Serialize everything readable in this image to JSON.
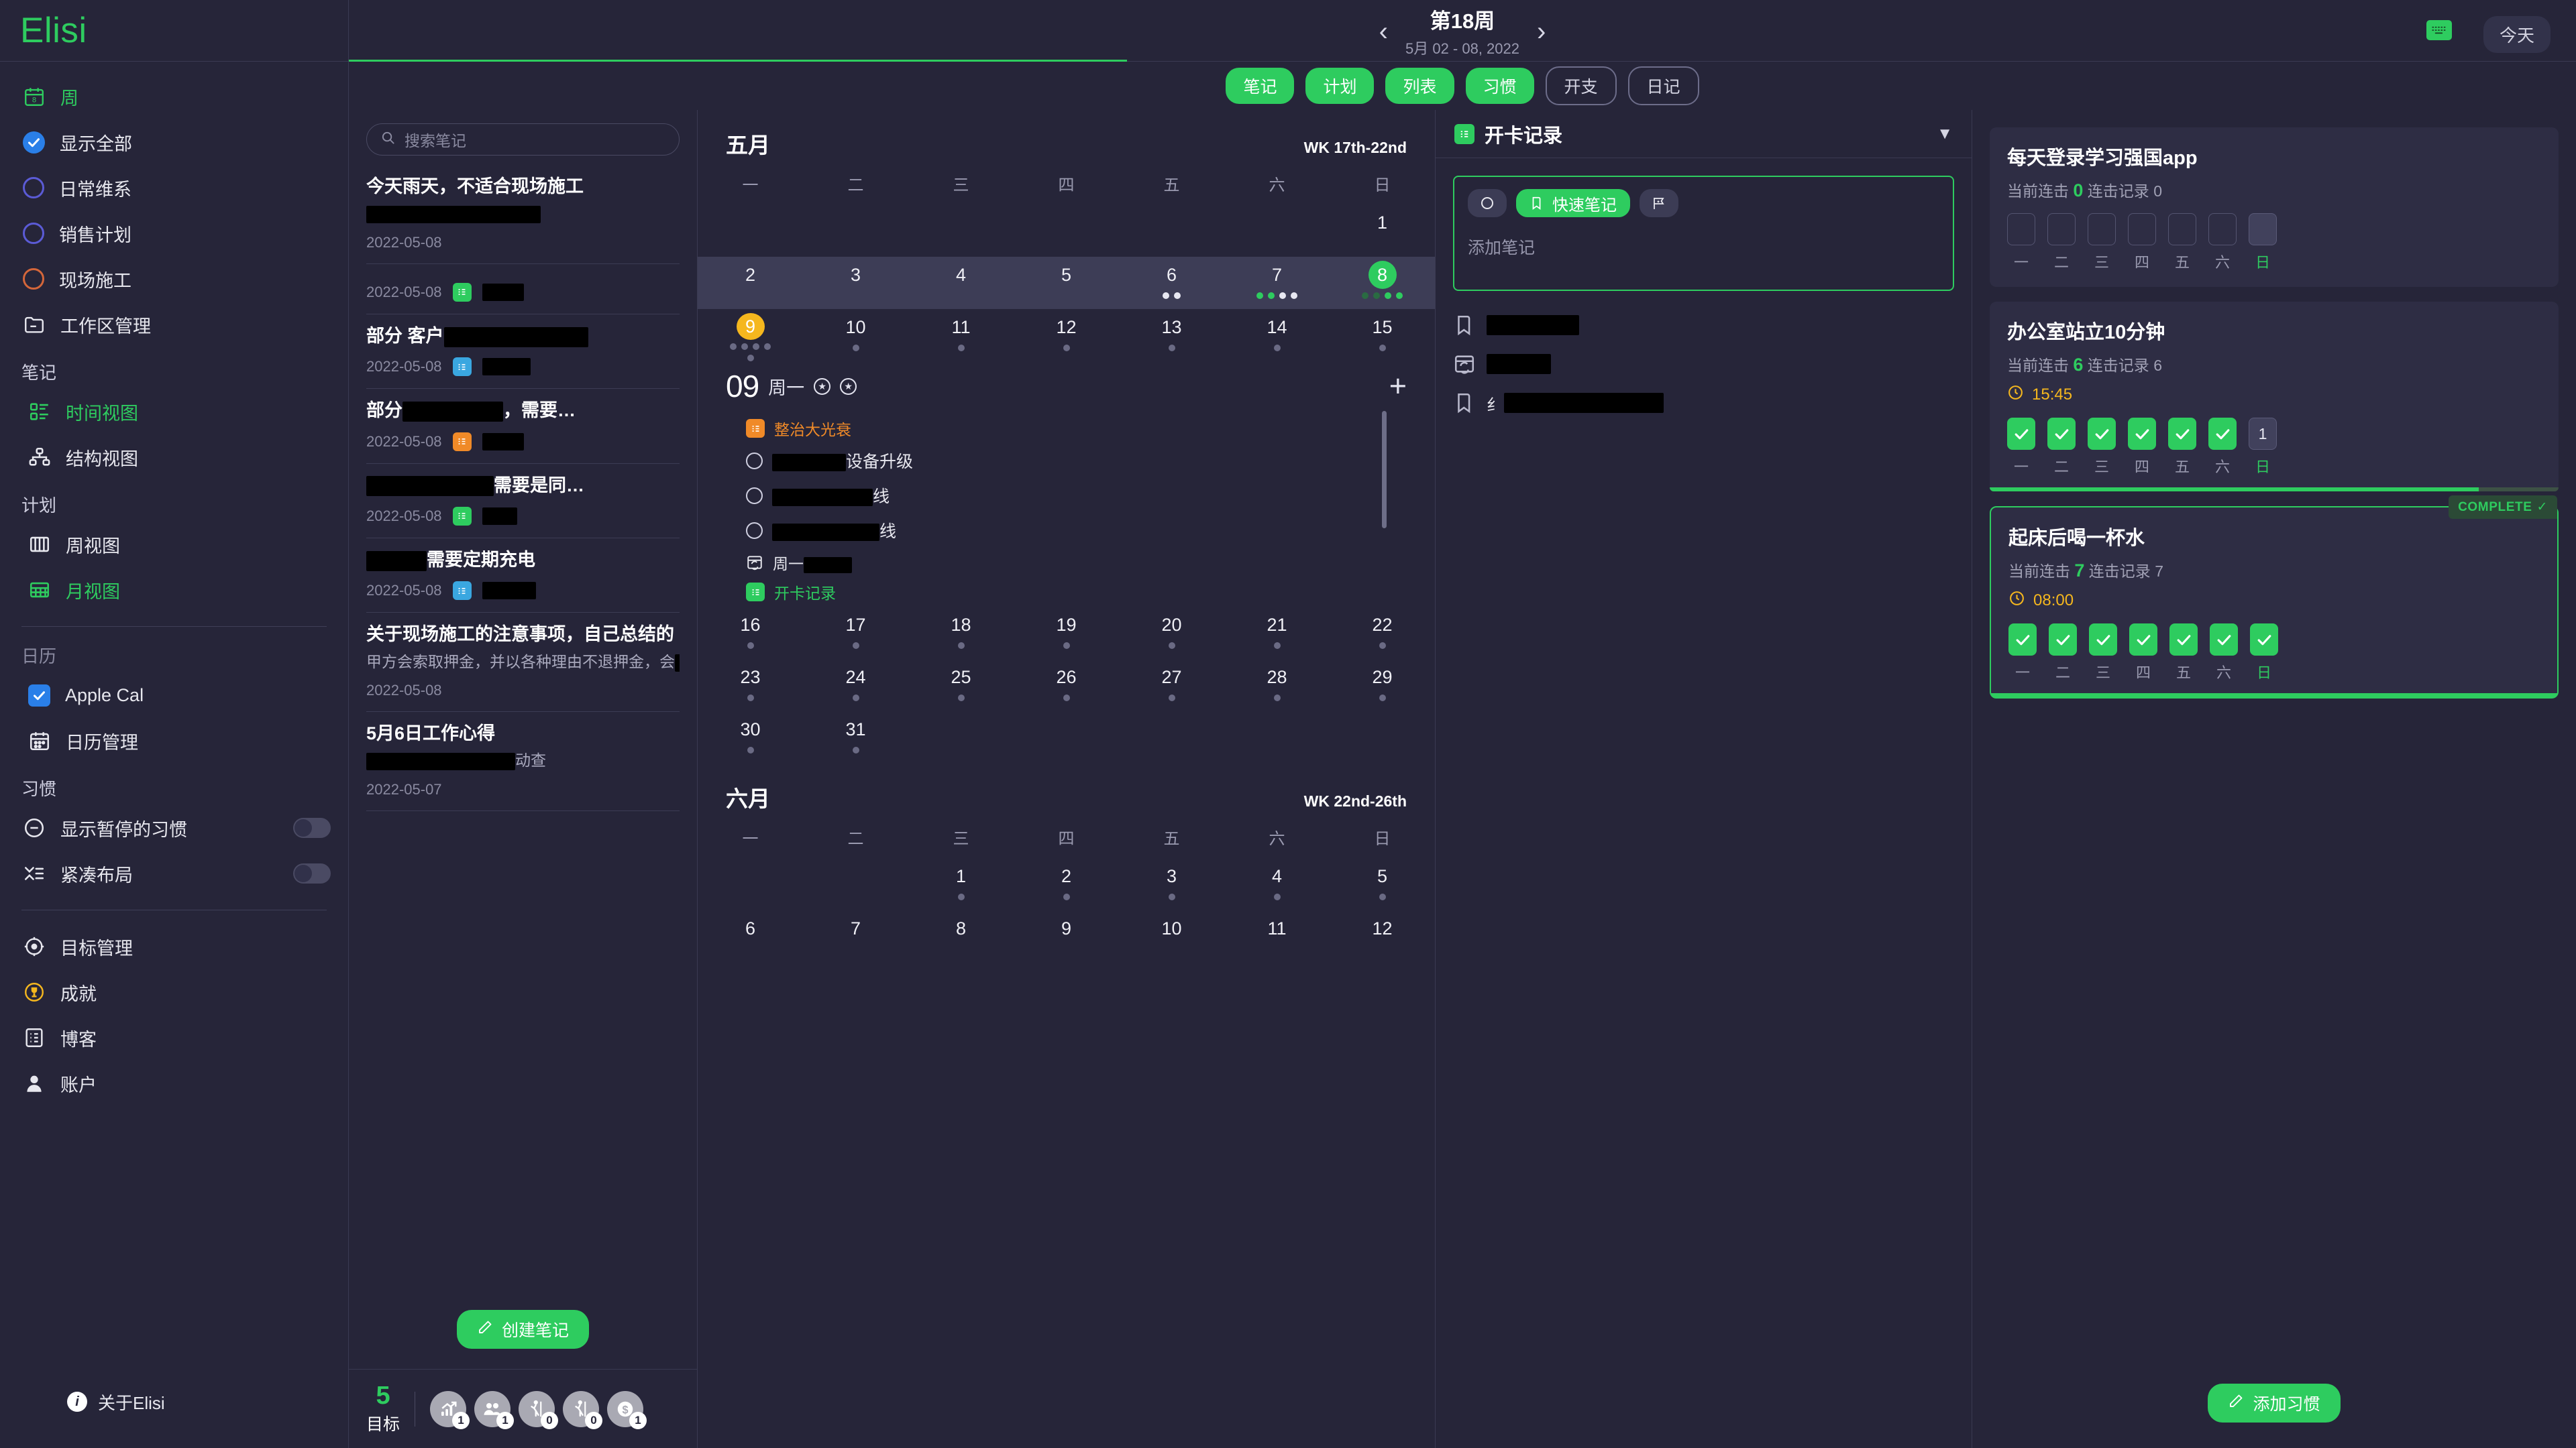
{
  "app": {
    "brand": "Elisi"
  },
  "sidebar": {
    "week_item": {
      "label": "周",
      "icon": "calendar-week-icon"
    },
    "filters": [
      {
        "label": "显示全部",
        "type": "checked",
        "color": "#2a7fe8"
      },
      {
        "label": "日常维系",
        "type": "circle",
        "color": "#5b5bd6"
      },
      {
        "label": "销售计划",
        "type": "circle",
        "color": "#5b5bd6"
      },
      {
        "label": "现场施工",
        "type": "circle",
        "color": "#d4663a"
      },
      {
        "label": "工作区管理",
        "type": "folder"
      }
    ],
    "notes_section": {
      "title": "笔记",
      "items": [
        {
          "label": "时间视图",
          "active": true,
          "icon": "list-view-icon"
        },
        {
          "label": "结构视图",
          "active": false,
          "icon": "structure-view-icon"
        }
      ]
    },
    "plan_section": {
      "title": "计划",
      "items": [
        {
          "label": "周视图",
          "active": false,
          "icon": "columns-icon"
        },
        {
          "label": "月视图",
          "active": true,
          "icon": "grid-icon"
        }
      ]
    },
    "calendar_section": {
      "title": "日历",
      "items": [
        {
          "label": "Apple Cal",
          "checked": true
        },
        {
          "label": "日历管理",
          "checked": false
        }
      ]
    },
    "habit_section": {
      "title": "习惯",
      "items": [
        {
          "label": "显示暂停的习惯",
          "toggle": false
        },
        {
          "label": "紧凑布局",
          "toggle": false
        }
      ]
    },
    "bottom_items": [
      {
        "label": "目标管理",
        "icon": "target-icon"
      },
      {
        "label": "成就",
        "icon": "trophy-icon"
      },
      {
        "label": "博客",
        "icon": "blog-icon"
      },
      {
        "label": "账户",
        "icon": "account-icon"
      }
    ],
    "about": "关于Elisi"
  },
  "header": {
    "week_title": "第18周",
    "week_sub": "5月 02 - 08, 2022",
    "prev": "‹",
    "next": "›",
    "today_btn": "今天",
    "keyboard_icon": "keyboard-icon"
  },
  "tabs": [
    {
      "label": "笔记",
      "active": true
    },
    {
      "label": "计划",
      "active": true
    },
    {
      "label": "列表",
      "active": true
    },
    {
      "label": "习惯",
      "active": true
    },
    {
      "label": "开支",
      "active": false
    },
    {
      "label": "日记",
      "active": false
    }
  ],
  "notes": {
    "search_placeholder": "搜索笔记",
    "create_label": "创建笔记",
    "items": [
      {
        "title": "今天雨天，不适合现场施工",
        "title_redact": 0,
        "snippet": "",
        "snippet_redact": 260,
        "date": "2022-05-08",
        "tag_color": "",
        "tag_redact": 0
      },
      {
        "title": "",
        "title_redact": 0,
        "snippet": "",
        "snippet_redact": 0,
        "date": "2022-05-08",
        "tag_color": "#2ecc5f",
        "tag_redact": 62
      },
      {
        "title": "部分 客户",
        "title_redact": 215,
        "snippet": "",
        "snippet_redact": 0,
        "date": "2022-05-08",
        "tag_color": "#3aa7e0",
        "tag_redact": 72
      },
      {
        "title": "部分",
        "title_redact": 150,
        "title_suffix": "，需要…",
        "snippet": "",
        "snippet_redact": 0,
        "date": "2022-05-08",
        "tag_color": "#f08a28",
        "tag_redact": 62
      },
      {
        "title": "",
        "title_redact": 190,
        "title_suffix": "需要是同…",
        "snippet": "",
        "snippet_redact": 0,
        "date": "2022-05-08",
        "tag_color": "#2ecc5f",
        "tag_redact": 52
      },
      {
        "title": "",
        "title_redact": 90,
        "title_suffix": "需要定期充电",
        "snippet": "",
        "snippet_redact": 0,
        "date": "2022-05-08",
        "tag_color": "#3aa7e0",
        "tag_redact": 80
      },
      {
        "title": "关于现场施工的注意事项，自己总结的",
        "title_redact": 0,
        "snippet": "甲方会索取押金，并以各种理由不退押金，会",
        "snippet_redact": 235,
        "date": "2022-05-08",
        "tag_color": "",
        "tag_redact": 0
      },
      {
        "title": "5月6日工作心得",
        "title_redact": 0,
        "snippet": "",
        "snippet_redact": 222,
        "snippet_suffix": "动查",
        "date": "2022-05-07",
        "tag_color": "",
        "tag_redact": 0
      }
    ]
  },
  "goalbar": {
    "count": "5",
    "label": "目标",
    "icons": [
      {
        "name": "growth-icon",
        "count": "1"
      },
      {
        "name": "people-icon",
        "count": "1"
      },
      {
        "name": "hiker-icon",
        "count": "0"
      },
      {
        "name": "hiker-icon",
        "count": "0"
      },
      {
        "name": "dollar-icon",
        "count": "1"
      }
    ]
  },
  "calendar": {
    "dow": [
      "一",
      "二",
      "三",
      "四",
      "五",
      "六",
      "日"
    ],
    "months": [
      {
        "name": "五月",
        "week_range": "WK 17th-22nd",
        "weeks": [
          {
            "highlight": false,
            "days": [
              {
                "n": "",
                "dots": []
              },
              {
                "n": "",
                "dots": []
              },
              {
                "n": "",
                "dots": []
              },
              {
                "n": "",
                "dots": []
              },
              {
                "n": "",
                "dots": []
              },
              {
                "n": "",
                "dots": []
              },
              {
                "n": "1",
                "dots": []
              }
            ]
          },
          {
            "highlight": true,
            "days": [
              {
                "n": "2",
                "dots": []
              },
              {
                "n": "3",
                "dots": []
              },
              {
                "n": "4",
                "dots": []
              },
              {
                "n": "5",
                "dots": []
              },
              {
                "n": "6",
                "dots": [
                  "w",
                  "w"
                ]
              },
              {
                "n": "7",
                "dots": [
                  "g",
                  "g",
                  "w",
                  "w"
                ]
              },
              {
                "n": "8",
                "state": "today",
                "dots": [
                  "dg",
                  "dg",
                  "g",
                  "g"
                ]
              }
            ]
          },
          {
            "highlight": false,
            "days": [
              {
                "n": "9",
                "state": "sel",
                "dots": [
                  "d",
                  "d",
                  "d",
                  "d",
                  "d"
                ]
              },
              {
                "n": "10",
                "dots": [
                  "d"
                ]
              },
              {
                "n": "11",
                "dots": [
                  "d"
                ]
              },
              {
                "n": "12",
                "dots": [
                  "d"
                ]
              },
              {
                "n": "13",
                "dots": [
                  "d"
                ]
              },
              {
                "n": "14",
                "dots": [
                  "d"
                ]
              },
              {
                "n": "15",
                "dots": [
                  "d"
                ]
              }
            ]
          }
        ]
      }
    ],
    "day_detail": {
      "day_num": "09",
      "dow": "周一",
      "badges": [
        "star-badge",
        "star-badge"
      ],
      "add": "+",
      "tag_orange": "整治大光衰",
      "tag_green": "开卡记录",
      "tasks": [
        {
          "redact": 110,
          "suffix": "设备升级"
        },
        {
          "redact": 150,
          "suffix": "线"
        },
        {
          "redact": 160,
          "suffix": "线"
        }
      ],
      "repeat_item": {
        "prefix": "周一",
        "redact": 72
      }
    },
    "lower_weeks": [
      {
        "days": [
          {
            "n": "16",
            "dots": [
              "d"
            ]
          },
          {
            "n": "17",
            "dots": [
              "d"
            ]
          },
          {
            "n": "18",
            "dots": [
              "d"
            ]
          },
          {
            "n": "19",
            "dots": [
              "d"
            ]
          },
          {
            "n": "20",
            "dots": [
              "d"
            ]
          },
          {
            "n": "21",
            "dots": [
              "d"
            ]
          },
          {
            "n": "22",
            "dots": [
              "d"
            ]
          }
        ]
      },
      {
        "days": [
          {
            "n": "23",
            "dots": [
              "d"
            ]
          },
          {
            "n": "24",
            "dots": [
              "d"
            ]
          },
          {
            "n": "25",
            "dots": [
              "d"
            ]
          },
          {
            "n": "26",
            "dots": [
              "d"
            ]
          },
          {
            "n": "27",
            "dots": [
              "d"
            ]
          },
          {
            "n": "28",
            "dots": [
              "d"
            ]
          },
          {
            "n": "29",
            "dots": [
              "d"
            ]
          }
        ]
      },
      {
        "days": [
          {
            "n": "30",
            "dots": [
              "d"
            ]
          },
          {
            "n": "31",
            "dots": [
              "d"
            ]
          },
          {
            "n": "",
            "dots": []
          },
          {
            "n": "",
            "dots": []
          },
          {
            "n": "",
            "dots": []
          },
          {
            "n": "",
            "dots": []
          },
          {
            "n": "",
            "dots": []
          }
        ]
      }
    ],
    "june": {
      "name": "六月",
      "week_range": "WK 22nd-26th",
      "weeks": [
        {
          "days": [
            {
              "n": "",
              "dots": []
            },
            {
              "n": "",
              "dots": []
            },
            {
              "n": "1",
              "dots": [
                "d"
              ]
            },
            {
              "n": "2",
              "dots": [
                "d"
              ]
            },
            {
              "n": "3",
              "dots": [
                "d"
              ]
            },
            {
              "n": "4",
              "dots": [
                "d"
              ]
            },
            {
              "n": "5",
              "dots": [
                "d"
              ]
            }
          ]
        },
        {
          "days": [
            {
              "n": "6",
              "dots": []
            },
            {
              "n": "7",
              "dots": []
            },
            {
              "n": "8",
              "dots": []
            },
            {
              "n": "9",
              "dots": []
            },
            {
              "n": "10",
              "dots": []
            },
            {
              "n": "11",
              "dots": []
            },
            {
              "n": "12",
              "dots": []
            }
          ]
        }
      ]
    }
  },
  "checkin": {
    "title": "开卡记录",
    "quick_note_label": "快速笔记",
    "placeholder": "添加笔记",
    "items": [
      {
        "icon": "bookmark-icon",
        "redact": 138
      },
      {
        "icon": "repeat-calendar-icon",
        "redact": 96
      },
      {
        "icon": "bookmark-icon",
        "prefix": "纟",
        "redact": 238
      }
    ]
  },
  "habits": {
    "add_label": "添加习惯",
    "dow": [
      "一",
      "二",
      "三",
      "四",
      "五",
      "六",
      "日"
    ],
    "complete_badge": "COMPLETE",
    "streak_label": "当前连击",
    "record_label": "连击记录",
    "cards": [
      {
        "title": "每天登录学习强国app",
        "streak": "0",
        "record": "0",
        "time": "",
        "days": [
          false,
          false,
          false,
          false,
          false,
          false,
          false
        ],
        "sunday_label": "",
        "progress": 0,
        "complete": false
      },
      {
        "title": "办公室站立10分钟",
        "streak": "6",
        "record": "6",
        "time": "15:45",
        "days": [
          true,
          true,
          true,
          true,
          true,
          true,
          false
        ],
        "sunday_label": "1",
        "progress": 86,
        "complete": false
      },
      {
        "title": "起床后喝一杯水",
        "streak": "7",
        "record": "7",
        "time": "08:00",
        "days": [
          true,
          true,
          true,
          true,
          true,
          true,
          true
        ],
        "sunday_label": "",
        "progress": 100,
        "complete": true
      }
    ]
  }
}
